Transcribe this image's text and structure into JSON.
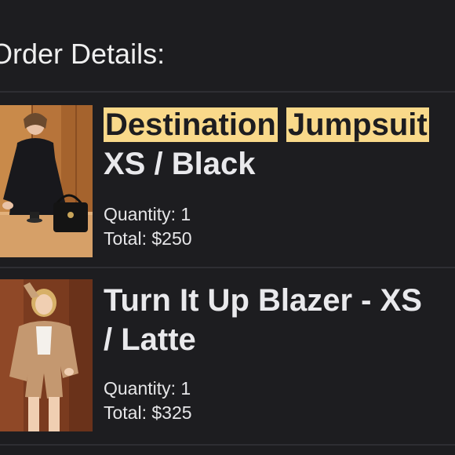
{
  "header": {
    "title": "Order Details:"
  },
  "items": [
    {
      "title_word1": "Destination",
      "title_word2": "Jumpsuit",
      "title_line2": "XS / Black",
      "quantity": "Quantity: 1",
      "total": "Total: $250",
      "image_desc": "product-photo-jumpsuit"
    },
    {
      "title_line1": "Turn It Up Blazer - XS",
      "title_line2": "/ Latte",
      "quantity": "Quantity: 1",
      "total": "Total: $325",
      "image_desc": "product-photo-blazer"
    }
  ],
  "colors": {
    "background": "#1d1d20",
    "highlight": "#f9d98a",
    "divider": "#2e2e33"
  }
}
